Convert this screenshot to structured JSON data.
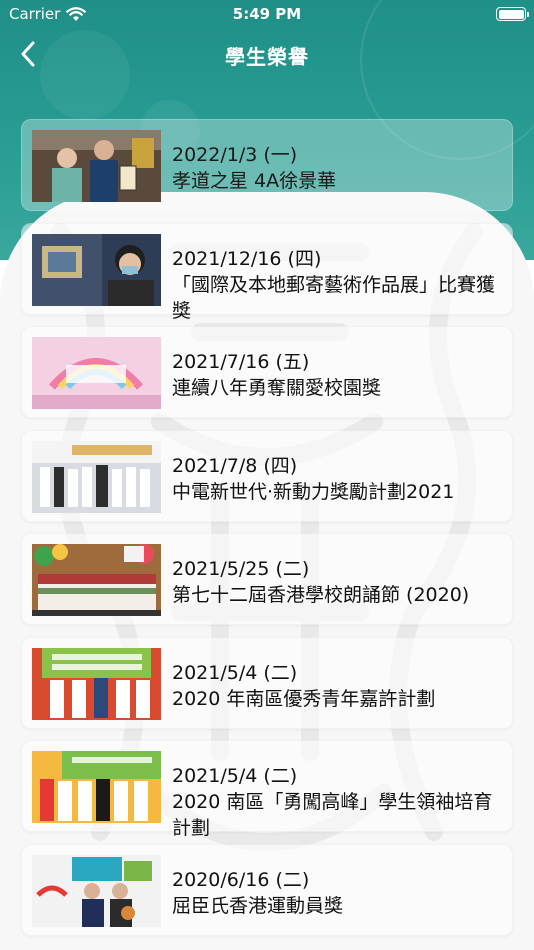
{
  "status_bar": {
    "carrier": "Carrier",
    "time": "5:49 PM"
  },
  "nav": {
    "title": "學生榮譽"
  },
  "items": [
    {
      "date": "2022/1/3 (一)",
      "title": "孝道之星  4A徐景華"
    },
    {
      "date": "2021/12/16 (四)",
      "title": "「國際及本地郵寄藝術作品展」比賽獲獎"
    },
    {
      "date": "2021/7/16 (五)",
      "title": "連續八年勇奪關愛校園獎"
    },
    {
      "date": "2021/7/8 (四)",
      "title": "中電新世代‧新動力獎勵計劃2021"
    },
    {
      "date": "2021/5/25 (二)",
      "title": "第七十二屆香港學校朗誦節 (2020)"
    },
    {
      "date": "2021/5/4 (二)",
      "title": "2020 年南區優秀青年嘉許計劃"
    },
    {
      "date": "2021/5/4 (二)",
      "title": "2020 南區「勇闖高峰」學生領袖培育計劃"
    },
    {
      "date": "2020/6/16 (二)",
      "title": "屈臣氏香港運動員獎"
    }
  ],
  "colors": {
    "header": "#1f8f87",
    "background": "#f7f7f7"
  }
}
